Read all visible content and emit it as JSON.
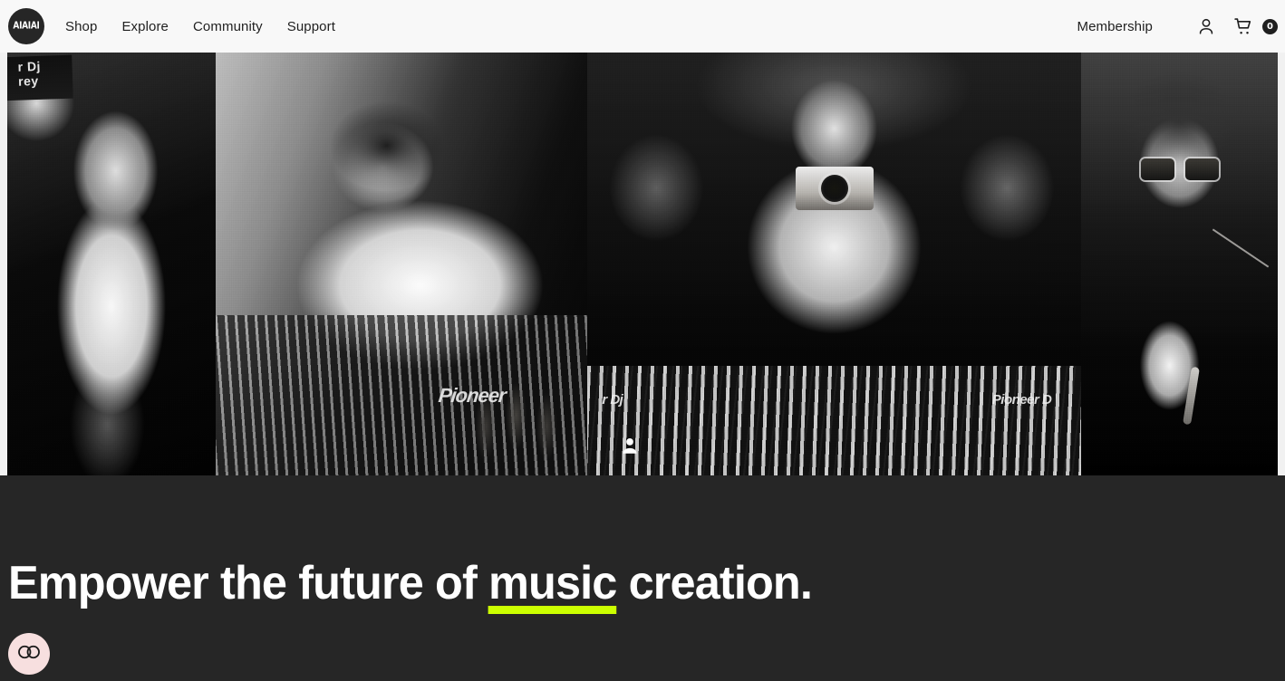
{
  "site": {
    "brand": "AIAIAI",
    "logo_text": "AIAIAI",
    "logo_icon": "aiaiai-logo-icon",
    "background_color": "#262626",
    "header_background_color": "#F8F8F8",
    "accent_color": "#CCFF00"
  },
  "header": {
    "nav": [
      {
        "label": "Shop"
      },
      {
        "label": "Explore"
      },
      {
        "label": "Community"
      },
      {
        "label": "Support"
      }
    ],
    "membership_label": "Membership",
    "account_icon": "user-account-icon",
    "cart_icon": "shopping-cart-icon",
    "cart_count": "0"
  },
  "hero": {
    "gallery_alt": "Black and white photo collage of DJs and artists",
    "panels": [
      {
        "id": "panel-1",
        "caption": "Vocalist holding a microphone in a dark club",
        "sign_line_1": "r Dj",
        "sign_line_2": "rey"
      },
      {
        "id": "panel-2",
        "caption": "DJ leaning over CDJ decks wearing headphones",
        "brand_text": "Pioneer"
      },
      {
        "id": "panel-3",
        "caption": "Crowd around the booth, person shooting a film camera",
        "brand_text": "Pioneer D",
        "brand_text_left": "r Dj",
        "avatar_icon": "person-avatar-icon"
      },
      {
        "id": "panel-4",
        "caption": "Portrait of an artist in oversized glasses with headphones",
        "caption_lower": "Performer at a microphone wearing headphones"
      }
    ]
  },
  "main": {
    "headline_part_1": "Empower the future of ",
    "headline_accent": "music",
    "headline_part_2": " creation."
  },
  "cookie_widget": {
    "icon": "cookie-consent-toggle-icon",
    "label": "Cookie preferences",
    "background_color": "#F7DFDF"
  }
}
